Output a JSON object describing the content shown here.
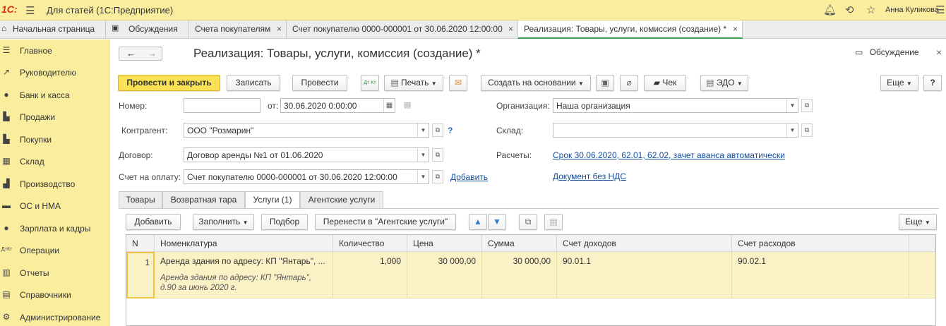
{
  "app": {
    "logo": "1С:",
    "title": "Для статей  (1С:Предприятие)",
    "user": "Анна Куликова"
  },
  "tabs": [
    {
      "label": "Начальная страница"
    },
    {
      "label": "Обсуждения"
    },
    {
      "label": "Счета покупателям"
    },
    {
      "label": "Счет покупателю 0000-000001 от 30.06.2020 12:00:00"
    },
    {
      "label": "Реализация: Товары, услуги, комиссия (создание) *"
    }
  ],
  "sidebar": {
    "items": [
      {
        "label": "Главное",
        "icon": "menu-icon"
      },
      {
        "label": "Руководителю",
        "icon": "chart-line-icon"
      },
      {
        "label": "Банк и касса",
        "icon": "coin-icon"
      },
      {
        "label": "Продажи",
        "icon": "cart-icon"
      },
      {
        "label": "Покупки",
        "icon": "cart-icon"
      },
      {
        "label": "Склад",
        "icon": "warehouse-icon"
      },
      {
        "label": "Производство",
        "icon": "factory-icon"
      },
      {
        "label": "ОС и НМА",
        "icon": "truck-icon"
      },
      {
        "label": "Зарплата и кадры",
        "icon": "person-icon"
      },
      {
        "label": "Операции",
        "icon": "dt-kt-icon"
      },
      {
        "label": "Отчеты",
        "icon": "bar-chart-icon"
      },
      {
        "label": "Справочники",
        "icon": "book-icon"
      },
      {
        "label": "Администрирование",
        "icon": "gear-icon"
      }
    ]
  },
  "document": {
    "title": "Реализация: Товары, услуги, комиссия (создание) *",
    "discussion": "Обсуждение"
  },
  "toolbar": {
    "post_close": "Провести и закрыть",
    "save": "Записать",
    "post": "Провести",
    "dtkt": "Дт Кт",
    "print": "Печать",
    "create_based": "Создать на основании",
    "check": "Чек",
    "edo": "ЭДО",
    "more": "Еще",
    "help": "?"
  },
  "form": {
    "number_label": "Номер:",
    "number_value": "",
    "date_label": "от:",
    "date_value": "30.06.2020  0:00:00",
    "org_label": "Организация:",
    "org_value": "Наша организация",
    "contractor_label": "Контрагент:",
    "contractor_value": "ООО \"Розмарин\"",
    "help_q": "?",
    "warehouse_label": "Склад:",
    "warehouse_value": "",
    "contract_label": "Договор:",
    "contract_value": "Договор аренды №1 от 01.06.2020",
    "settlements_label": "Расчеты:",
    "settlements_link": "Срок 30.06.2020, 62.01, 62.02, зачет аванса автоматически",
    "invoice_label": "Счет на оплату:",
    "invoice_value": "Счет покупателю 0000-000001 от 30.06.2020 12:00:00",
    "add_link": "Добавить",
    "vat_link": "Документ без НДС"
  },
  "form_tabs": [
    {
      "label": "Товары"
    },
    {
      "label": "Возвратная тара"
    },
    {
      "label": "Услуги (1)"
    },
    {
      "label": "Агентские услуги"
    }
  ],
  "table_toolbar": {
    "add": "Добавить",
    "fill": "Заполнить",
    "pick": "Подбор",
    "move": "Перенести в \"Агентские услуги\"",
    "more": "Еще"
  },
  "table": {
    "columns": [
      "N",
      "Номенклатура",
      "Количество",
      "Цена",
      "Сумма",
      "Счет доходов",
      "Счет расходов"
    ],
    "rows": [
      {
        "n": "1",
        "item": "Аренда здания по адресу: КП \"Янтарь\", ...",
        "item_desc": "Аренда здания по адресу: КП \"Янтарь\", д.90 за июнь 2020 г.",
        "qty": "1,000",
        "price": "30 000,00",
        "sum": "30 000,00",
        "income": "90.01.1",
        "expense": "90.02.1"
      }
    ]
  }
}
